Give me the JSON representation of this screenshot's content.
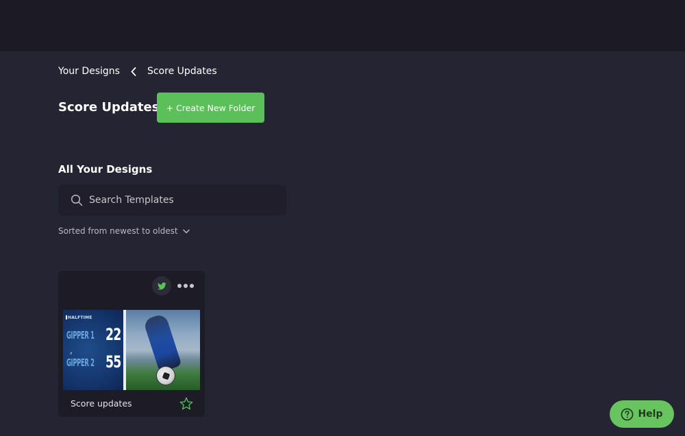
{
  "breadcrumb": {
    "parent": "Your Designs",
    "current": "Score Updates",
    "separator_icon": "chevron-left-icon"
  },
  "page": {
    "title": "Score Updates",
    "create_folder_label": "+ Create New Folder"
  },
  "designs": {
    "section_title": "All Your Designs",
    "search_placeholder": "Search Templates",
    "sort_label": "Sorted from newest to oldest",
    "items": [
      {
        "name": "Score updates",
        "platform_icon": "twitter-icon",
        "thumbnail": {
          "label": "HALFTIME",
          "team1": "GIPPER 1",
          "score1": "22",
          "versus": "x",
          "team2": "GIPPER 2",
          "score2": "55"
        }
      }
    ]
  },
  "help": {
    "label": "Help"
  },
  "colors": {
    "accent_green": "#5cc05a",
    "background": "#252433",
    "topbar": "#1c1b25",
    "card": "#1d1c26"
  }
}
